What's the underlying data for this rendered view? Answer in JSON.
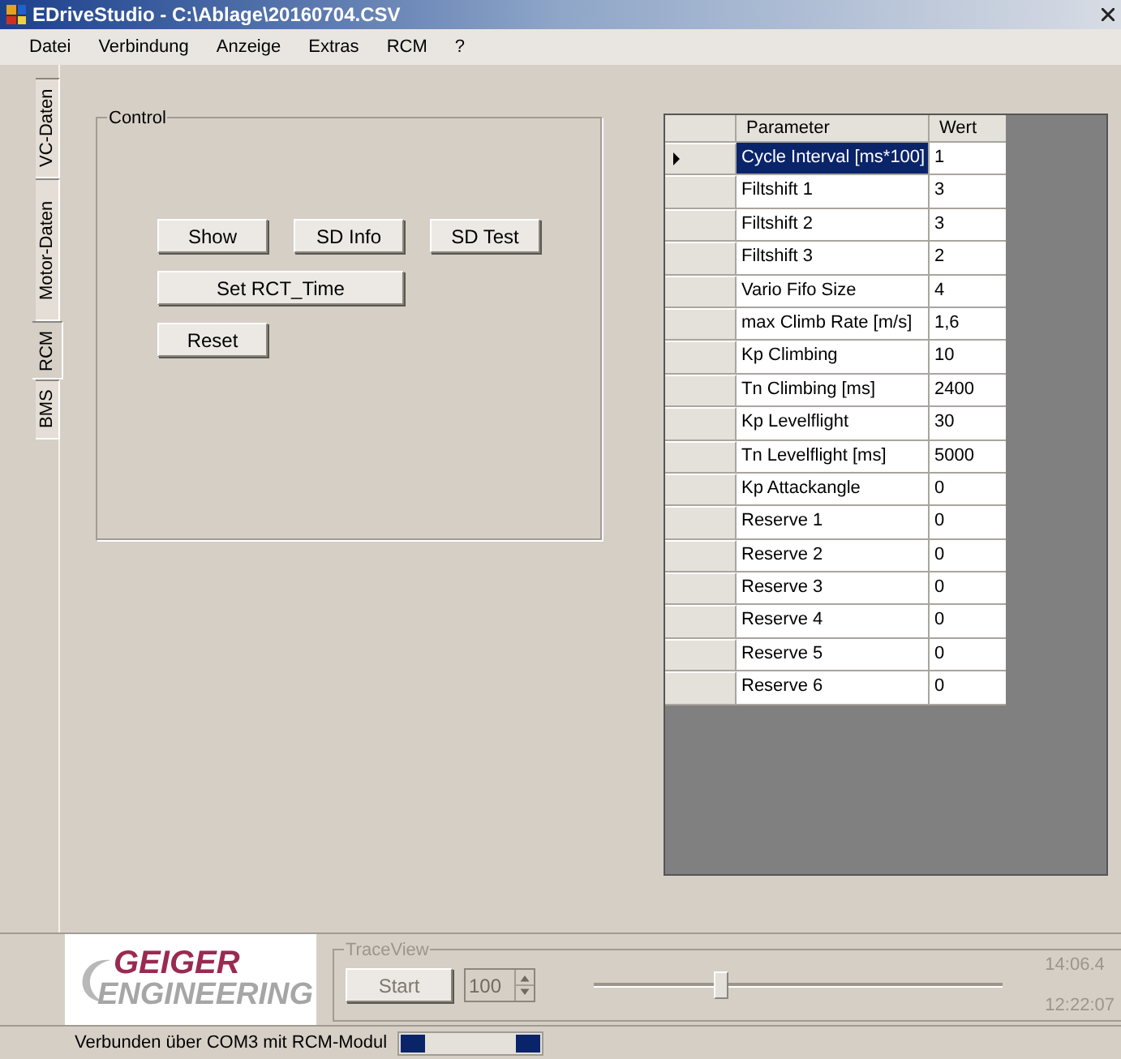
{
  "window": {
    "title": "EDriveStudio - C:\\Ablage\\20160704.CSV"
  },
  "menu": [
    "Datei",
    "Verbindung",
    "Anzeige",
    "Extras",
    "RCM",
    "?"
  ],
  "tabs": [
    {
      "label": "VC-Daten",
      "selected": false
    },
    {
      "label": "Motor-Daten",
      "selected": false
    },
    {
      "label": "RCM",
      "selected": true
    },
    {
      "label": "BMS",
      "selected": false
    }
  ],
  "control": {
    "title": "Control",
    "buttons": [
      "Show",
      "SD Info",
      "SD Test"
    ],
    "set_time_button": "Set RCT_Time",
    "reset_button": "Reset"
  },
  "table": {
    "columns": [
      "Parameter",
      "Wert"
    ],
    "rows": [
      {
        "parameter": "Cycle Interval [ms*100]",
        "value": "1",
        "selected": true
      },
      {
        "parameter": "Filtshift 1",
        "value": "3",
        "selected": false
      },
      {
        "parameter": "Filtshift 2",
        "value": "3",
        "selected": false
      },
      {
        "parameter": "Filtshift 3",
        "value": "2",
        "selected": false
      },
      {
        "parameter": "Vario Fifo Size",
        "value": "4",
        "selected": false
      },
      {
        "parameter": "max Climb Rate [m/s]",
        "value": "1,6",
        "selected": false
      },
      {
        "parameter": "Kp Climbing",
        "value": "10",
        "selected": false
      },
      {
        "parameter": "Tn Climbing [ms]",
        "value": "2400",
        "selected": false
      },
      {
        "parameter": "Kp Levelflight",
        "value": "30",
        "selected": false
      },
      {
        "parameter": "Tn Levelflight [ms]",
        "value": "5000",
        "selected": false
      },
      {
        "parameter": "Kp Attackangle",
        "value": "0",
        "selected": false
      },
      {
        "parameter": "Reserve 1",
        "value": "0",
        "selected": false
      },
      {
        "parameter": "Reserve 2",
        "value": "0",
        "selected": false
      },
      {
        "parameter": "Reserve 3",
        "value": "0",
        "selected": false
      },
      {
        "parameter": "Reserve 4",
        "value": "0",
        "selected": false
      },
      {
        "parameter": "Reserve 5",
        "value": "0",
        "selected": false
      },
      {
        "parameter": "Reserve 6",
        "value": "0",
        "selected": false
      }
    ]
  },
  "logo": {
    "line_1": "GEIGER",
    "line_2": "ENGINEERING"
  },
  "trace_view": {
    "title": "TraceView",
    "start_button": {
      "label": "Start",
      "disabled": true
    },
    "count_field": {
      "value": "100",
      "disabled": true
    },
    "slider": {
      "level": 0.31
    },
    "time_1": "14:06.4",
    "time_2": "12:22:07"
  },
  "status_bar": {
    "text": "Verbunden über COM3 mit RCM-Modul"
  }
}
